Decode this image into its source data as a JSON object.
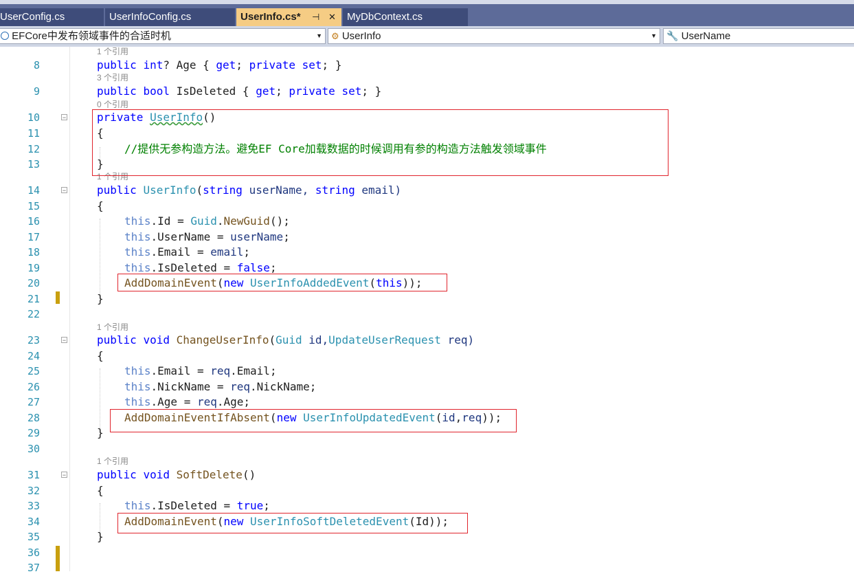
{
  "tabs": [
    {
      "label": "UserConfig.cs",
      "active": false
    },
    {
      "label": "UserInfoConfig.cs",
      "active": false
    },
    {
      "label": "UserInfo.cs*",
      "active": true,
      "pin": "⊣",
      "close": "✕"
    },
    {
      "label": "MyDbContext.cs",
      "active": false
    }
  ],
  "navbar": {
    "project": "EFCore中发布领域事件的合适时机",
    "type": "UserInfo",
    "member": "UserName"
  },
  "references": {
    "age": "1 个引用",
    "isdeleted": "3 个引用",
    "ctor_private": "0 个引用",
    "ctor_public": "1 个引用",
    "change": "1 个引用",
    "softdelete": "1 个引用"
  },
  "code": {
    "l8": [
      "public ",
      "int",
      "? Age { ",
      "get",
      "; ",
      "private ",
      "set",
      "; }"
    ],
    "l9": [
      "public ",
      "bool",
      " IsDeleted { ",
      "get",
      "; ",
      "private ",
      "set",
      "; }"
    ],
    "l10": [
      "private ",
      "UserInfo",
      "()"
    ],
    "l11": "{",
    "l12": "//提供无参构造方法。避免EF Core加载数据的时候调用有参的构造方法触发领域事件",
    "l13": "}",
    "l14": [
      "public ",
      "UserInfo",
      "(",
      "string",
      " userName, ",
      "string",
      " email)"
    ],
    "l15": "{",
    "l16": [
      "this",
      ".Id = ",
      "Guid",
      ".",
      "NewGuid",
      "();"
    ],
    "l17": [
      "this",
      ".UserName = ",
      "userName",
      ";"
    ],
    "l18": [
      "this",
      ".Email = ",
      "email",
      ";"
    ],
    "l19": [
      "this",
      ".IsDeleted = ",
      "false",
      ";"
    ],
    "l20": [
      "AddDomainEvent",
      "(",
      "new ",
      "UserInfoAddedEvent",
      "(",
      "this",
      "));"
    ],
    "l21": "}",
    "l23": [
      "public ",
      "void ",
      "ChangeUserInfo",
      "(",
      "Guid",
      " id,",
      "UpdateUserRequest",
      " req)"
    ],
    "l24": "{",
    "l25": [
      "this",
      ".Email = ",
      "req",
      ".Email;"
    ],
    "l26": [
      "this",
      ".NickName = ",
      "req",
      ".NickName;"
    ],
    "l27": [
      "this",
      ".Age = ",
      "req",
      ".Age;"
    ],
    "l28": [
      "AddDomainEventIfAbsent",
      "(",
      "new ",
      "UserInfoUpdatedEvent",
      "(",
      "id",
      ",",
      "req",
      "));"
    ],
    "l29": "}",
    "l31": [
      "public ",
      "void ",
      "SoftDelete",
      "()"
    ],
    "l32": "{",
    "l33": [
      "this",
      ".IsDeleted = ",
      "true",
      ";"
    ],
    "l34": [
      "AddDomainEvent",
      "(",
      "new ",
      "UserInfoSoftDeletedEvent",
      "(Id));"
    ],
    "l35": "}"
  },
  "line_numbers": [
    "8",
    "9",
    "10",
    "11",
    "12",
    "13",
    "14",
    "15",
    "16",
    "17",
    "18",
    "19",
    "20",
    "21",
    "22",
    "23",
    "24",
    "25",
    "26",
    "27",
    "28",
    "29",
    "30",
    "31",
    "32",
    "33",
    "34",
    "35",
    "36",
    "37"
  ],
  "colors": {
    "keyword": "#0000ff",
    "type": "#2b91af",
    "comment": "#008000",
    "method": "#74531f",
    "param": "#1f377f",
    "highlight_box": "#e0242c",
    "tab_active": "#f5cc84"
  }
}
